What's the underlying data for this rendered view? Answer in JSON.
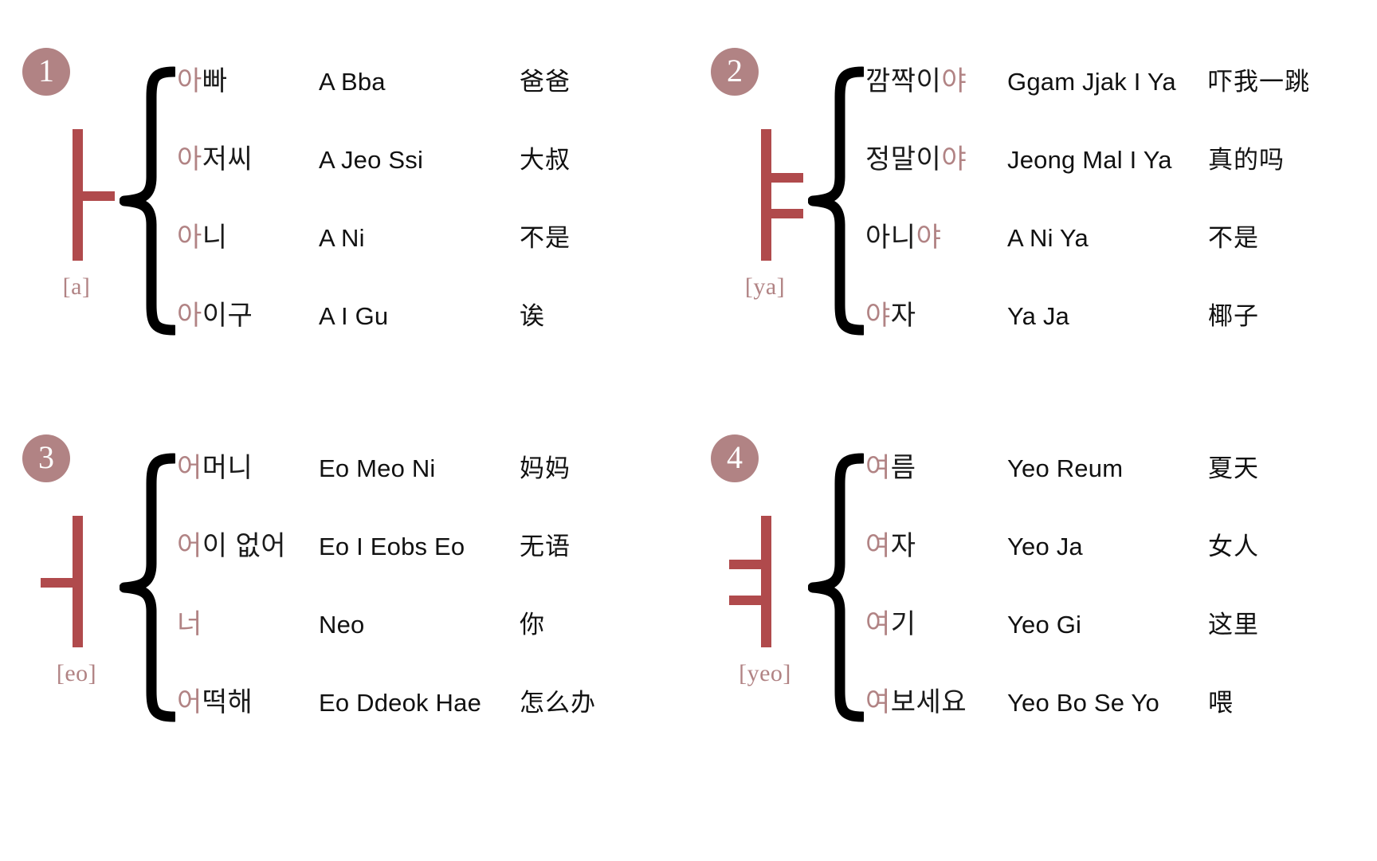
{
  "accent_colors": {
    "badge_fill": "#b18384",
    "vowel_letter": "#b04a4c",
    "highlight_syllable": "#b18384",
    "text": "#111111",
    "brace": "#000000",
    "background": "#ffffff"
  },
  "panels": [
    {
      "number": "1",
      "vowel": "ㅏ",
      "vowel_shape": "stem-with-one-right-arm",
      "romaja": "[a]",
      "rows": [
        {
          "hangul_pre": "",
          "hangul_hl": "아",
          "hangul_post": "빠",
          "romanization": "A Bba",
          "chinese": "爸爸"
        },
        {
          "hangul_pre": "",
          "hangul_hl": "아",
          "hangul_post": "저씨",
          "romanization": "A Jeo Ssi",
          "chinese": "大叔"
        },
        {
          "hangul_pre": "",
          "hangul_hl": "아",
          "hangul_post": "니",
          "romanization": "A Ni",
          "chinese": "不是"
        },
        {
          "hangul_pre": "",
          "hangul_hl": "아",
          "hangul_post": "이구",
          "romanization": "A I Gu",
          "chinese": "诶"
        }
      ]
    },
    {
      "number": "2",
      "vowel": "ㅑ",
      "vowel_shape": "stem-with-two-right-arms",
      "romaja": "[ya]",
      "rows": [
        {
          "hangul_pre": "깜짝이",
          "hangul_hl": "야",
          "hangul_post": "",
          "romanization": "Ggam Jjak I Ya",
          "chinese": "吓我一跳"
        },
        {
          "hangul_pre": "정말이",
          "hangul_hl": "야",
          "hangul_post": "",
          "romanization": "Jeong Mal I Ya",
          "chinese": "真的吗"
        },
        {
          "hangul_pre": "아니",
          "hangul_hl": "야",
          "hangul_post": "",
          "romanization": "A Ni Ya",
          "chinese": "不是"
        },
        {
          "hangul_pre": "",
          "hangul_hl": "야",
          "hangul_post": "자",
          "romanization": "Ya Ja",
          "chinese": "椰子"
        }
      ]
    },
    {
      "number": "3",
      "vowel": "ㅓ",
      "vowel_shape": "stem-with-one-left-arm",
      "romaja": "[eo]",
      "rows": [
        {
          "hangul_pre": "",
          "hangul_hl": "어",
          "hangul_post": "머니",
          "romanization": "Eo Meo Ni",
          "chinese": "妈妈"
        },
        {
          "hangul_pre": "",
          "hangul_hl": "어",
          "hangul_post": "이 없어",
          "romanization": "Eo I Eobs Eo",
          "chinese": "无语"
        },
        {
          "hangul_pre": "",
          "hangul_hl": "너",
          "hangul_post": "",
          "romanization": "Neo",
          "chinese": "你"
        },
        {
          "hangul_pre": "",
          "hangul_hl": "어",
          "hangul_post": "떡해",
          "romanization": "Eo Ddeok Hae",
          "chinese": "怎么办"
        }
      ]
    },
    {
      "number": "4",
      "vowel": "ㅕ",
      "vowel_shape": "stem-with-two-left-arms",
      "romaja": "[yeo]",
      "rows": [
        {
          "hangul_pre": "",
          "hangul_hl": "여",
          "hangul_post": "름",
          "romanization": "Yeo Reum",
          "chinese": "夏天"
        },
        {
          "hangul_pre": "",
          "hangul_hl": "여",
          "hangul_post": "자",
          "romanization": "Yeo Ja",
          "chinese": "女人"
        },
        {
          "hangul_pre": "",
          "hangul_hl": "여",
          "hangul_post": "기",
          "romanization": "Yeo Gi",
          "chinese": "这里"
        },
        {
          "hangul_pre": "",
          "hangul_hl": "여",
          "hangul_post": "보세요",
          "romanization": "Yeo Bo Se Yo",
          "chinese": "喂"
        }
      ]
    }
  ]
}
